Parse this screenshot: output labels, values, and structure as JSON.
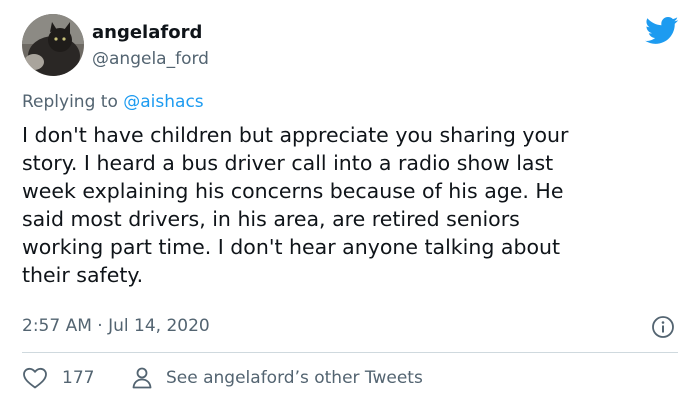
{
  "user": {
    "display_name": "angelaford",
    "handle": "@angela_ford"
  },
  "reply": {
    "prefix": "Replying to ",
    "mention": "@aishacs"
  },
  "tweet": {
    "lines": [
      "I don't have children but appreciate you sharing your",
      "story. I heard a bus driver call into a radio show last",
      "week explaining his concerns because of his age. He",
      "said most drivers, in his area, are retired seniors",
      "working part time. I don't hear anyone talking about",
      "their safety."
    ],
    "timestamp": "2:57 AM · Jul 14, 2020"
  },
  "actions": {
    "like_count": "177",
    "other_tweets_label": "See angelaford’s other Tweets"
  },
  "icons": {
    "brand": "twitter-bird-icon",
    "info": "info-icon",
    "like": "heart-icon",
    "profile": "person-icon"
  },
  "colors": {
    "brand_blue": "#1d9bf0",
    "secondary_text": "#536471",
    "divider": "#cfd9de"
  }
}
